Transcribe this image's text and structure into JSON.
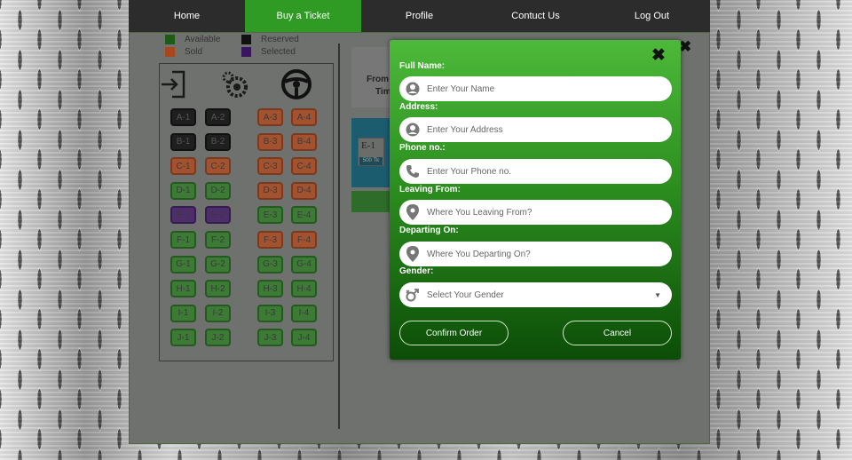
{
  "nav": {
    "items": [
      {
        "label": "Home",
        "active": false
      },
      {
        "label": "Buy a Ticket",
        "active": true
      },
      {
        "label": "Profile",
        "active": false
      },
      {
        "label": "Contuct Us",
        "active": false
      },
      {
        "label": "Log Out",
        "active": false
      }
    ]
  },
  "legend": {
    "available": {
      "label": "Available",
      "color": "#1c5c16"
    },
    "reserved": {
      "label": "Reserved",
      "color": "#111111"
    },
    "sold": {
      "label": "Sold",
      "color": "#a8461d"
    },
    "selected": {
      "label": "Selected",
      "color": "#3a1560"
    }
  },
  "seat_map": {
    "icons": [
      "entrance-icon",
      "engine-icon",
      "steering-wheel-icon"
    ],
    "rows": [
      [
        {
          "label": "A-1",
          "status": "reserved"
        },
        {
          "label": "A-2",
          "status": "reserved"
        },
        {
          "label": "A-3",
          "status": "sold"
        },
        {
          "label": "A-4",
          "status": "sold"
        }
      ],
      [
        {
          "label": "B-1",
          "status": "reserved"
        },
        {
          "label": "B-2",
          "status": "reserved"
        },
        {
          "label": "B-3",
          "status": "sold"
        },
        {
          "label": "B-4",
          "status": "sold"
        }
      ],
      [
        {
          "label": "C-1",
          "status": "sold"
        },
        {
          "label": "C-2",
          "status": "sold"
        },
        {
          "label": "C-3",
          "status": "sold"
        },
        {
          "label": "C-4",
          "status": "sold"
        }
      ],
      [
        {
          "label": "D-1",
          "status": "available"
        },
        {
          "label": "D-2",
          "status": "available"
        },
        {
          "label": "D-3",
          "status": "sold"
        },
        {
          "label": "D-4",
          "status": "sold"
        }
      ],
      [
        {
          "label": "E-1",
          "status": "selected"
        },
        {
          "label": "E-2",
          "status": "selected"
        },
        {
          "label": "E-3",
          "status": "available"
        },
        {
          "label": "E-4",
          "status": "available"
        }
      ],
      [
        {
          "label": "F-1",
          "status": "available"
        },
        {
          "label": "F-2",
          "status": "available"
        },
        {
          "label": "F-3",
          "status": "sold"
        },
        {
          "label": "F-4",
          "status": "sold"
        }
      ],
      [
        {
          "label": "G-1",
          "status": "available"
        },
        {
          "label": "G-2",
          "status": "available"
        },
        {
          "label": "G-3",
          "status": "available"
        },
        {
          "label": "G-4",
          "status": "available"
        }
      ],
      [
        {
          "label": "H-1",
          "status": "available"
        },
        {
          "label": "H-2",
          "status": "available"
        },
        {
          "label": "H-3",
          "status": "available"
        },
        {
          "label": "H-4",
          "status": "available"
        }
      ],
      [
        {
          "label": "I-1",
          "status": "available"
        },
        {
          "label": "I-2",
          "status": "available"
        },
        {
          "label": "I-3",
          "status": "available"
        },
        {
          "label": "I-4",
          "status": "available"
        }
      ],
      [
        {
          "label": "J-1",
          "status": "available"
        },
        {
          "label": "J-2",
          "status": "available"
        },
        {
          "label": "J-3",
          "status": "available"
        },
        {
          "label": "J-4",
          "status": "available"
        }
      ]
    ]
  },
  "background_panel": {
    "from_label": "From",
    "time_label": "Tim",
    "selected_seat_label": "E-1",
    "selected_seat_price": "500 Tk"
  },
  "modal": {
    "fields": [
      {
        "label": "Full Name:",
        "placeholder": "Enter Your Name",
        "icon": "user-icon"
      },
      {
        "label": "Address:",
        "placeholder": "Enter Your Address",
        "icon": "user-icon"
      },
      {
        "label": "Phone no.:",
        "placeholder": "Enter Your Phone no.",
        "icon": "phone-icon"
      },
      {
        "label": "Leaving From:",
        "placeholder": "Where You Leaving From?",
        "icon": "location-pin-icon"
      },
      {
        "label": "Departing On:",
        "placeholder": "Where You Departing On?",
        "icon": "location-pin-icon"
      }
    ],
    "gender": {
      "label": "Gender:",
      "value": "Select Your Gender",
      "icon": "gender-icon"
    },
    "confirm_label": "Confirm Order",
    "cancel_label": "Cancel",
    "close_symbol": "✖",
    "outer_close_symbol": "✖"
  }
}
